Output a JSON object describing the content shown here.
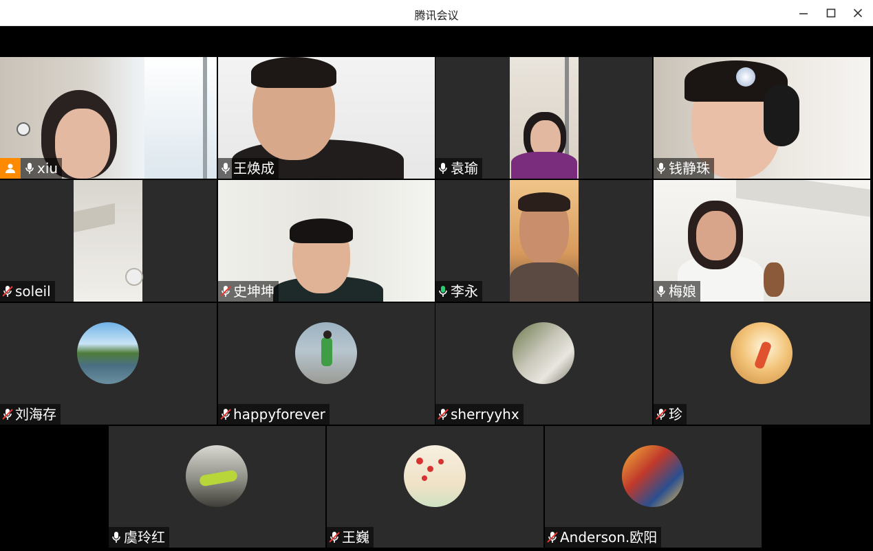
{
  "window": {
    "title": "腾讯会议",
    "controls": [
      "minimize",
      "maximize",
      "close"
    ]
  },
  "colors": {
    "background": "#000000",
    "tile": "#2b2b2b",
    "host_badge": "#ff8a00",
    "speaking": "#2ecc71",
    "muted_slash": "#e53935"
  },
  "participants": [
    {
      "name": "xiu",
      "host": true,
      "mic": "on",
      "video": "on",
      "speaking": false
    },
    {
      "name": "王焕成",
      "host": false,
      "mic": "on",
      "video": "on",
      "speaking": false
    },
    {
      "name": "袁瑜",
      "host": false,
      "mic": "on",
      "video": "on",
      "speaking": false
    },
    {
      "name": "钱静珠",
      "host": false,
      "mic": "on",
      "video": "on",
      "speaking": false
    },
    {
      "name": "soleil",
      "host": false,
      "mic": "muted",
      "video": "on",
      "speaking": false
    },
    {
      "name": "史坤坤",
      "host": false,
      "mic": "muted",
      "video": "on",
      "speaking": false
    },
    {
      "name": "李永",
      "host": false,
      "mic": "speaking",
      "video": "on",
      "speaking": true
    },
    {
      "name": "梅娘",
      "host": false,
      "mic": "on",
      "video": "on",
      "speaking": false
    },
    {
      "name": "刘海存",
      "host": false,
      "mic": "muted",
      "video": "off",
      "avatar_icon": "river-landscape-avatar"
    },
    {
      "name": "happyforever",
      "host": false,
      "mic": "muted",
      "video": "off",
      "avatar_icon": "child-walking-avatar"
    },
    {
      "name": "sherryyhx",
      "host": false,
      "mic": "muted",
      "video": "off",
      "avatar_icon": "flowers-avatar"
    },
    {
      "name": "珍",
      "host": false,
      "mic": "muted",
      "video": "off",
      "avatar_icon": "running-sunset-avatar"
    },
    {
      "name": "虞玲红",
      "host": false,
      "mic": "on",
      "video": "off",
      "avatar_icon": "woman-lounging-avatar"
    },
    {
      "name": "王巍",
      "host": false,
      "mic": "muted",
      "video": "off",
      "avatar_icon": "plum-blossom-avatar"
    },
    {
      "name": "Anderson.欧阳",
      "host": false,
      "mic": "muted",
      "video": "off",
      "avatar_icon": "superhero-avatar"
    }
  ]
}
